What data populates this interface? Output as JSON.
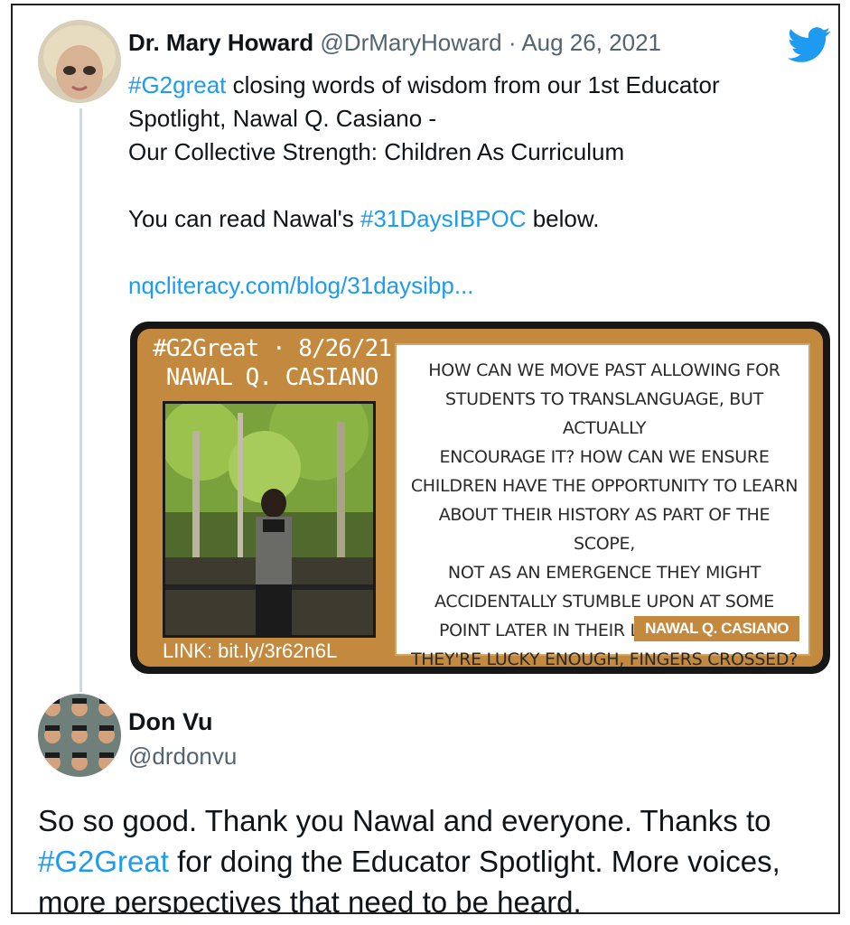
{
  "tweet1": {
    "name": "Dr. Mary Howard",
    "handle": "@DrMaryHoward",
    "separator": "·",
    "date": "Aug 26, 2021",
    "hashtag1": "#G2great",
    "line1_rest": " closing words of wisdom from our 1st Educator",
    "line2": "Spotlight, Nawal Q. Casiano -",
    "line3": "Our Collective Strength: Children As Curriculum",
    "line4_pre": "You can read Nawal's ",
    "hashtag2": "#31DaysIBPOC",
    "line4_post": " below.",
    "url": "nqcliteracy.com/blog/31daysibp..."
  },
  "card": {
    "title_line1": "#G2Great · 8/26/21",
    "title_line2": "NAWAL Q. CASIANO",
    "link": "LINK: bit.ly/3r62n6L",
    "quote_lines": [
      "How can we move past allowing for",
      "students to translanguage, but actually",
      "encourage it? How can we ensure",
      "children have the opportunity to learn",
      "about their history as part of the scope,",
      "not as an emergence they might",
      "accidentally stumble upon at some",
      "point later in their lives- maybe, if",
      "they're lucky enough, fingers crossed?"
    ],
    "quote_author": "NAWAL Q. CASIANO"
  },
  "tweet2": {
    "name": "Don Vu",
    "handle": "@drdonvu",
    "body_part1": "So so good. Thank you Nawal and everyone. Thanks to ",
    "hashtag": "#G2Great",
    "body_part2": " for doing the Educator Spotlight. More voices, more perspectives that need to be heard."
  },
  "colors": {
    "link": "#1d9bf0",
    "secondary_text": "#536471",
    "card_accent": "#c38a3f"
  },
  "icons": {
    "brand": "twitter-bird-icon"
  }
}
